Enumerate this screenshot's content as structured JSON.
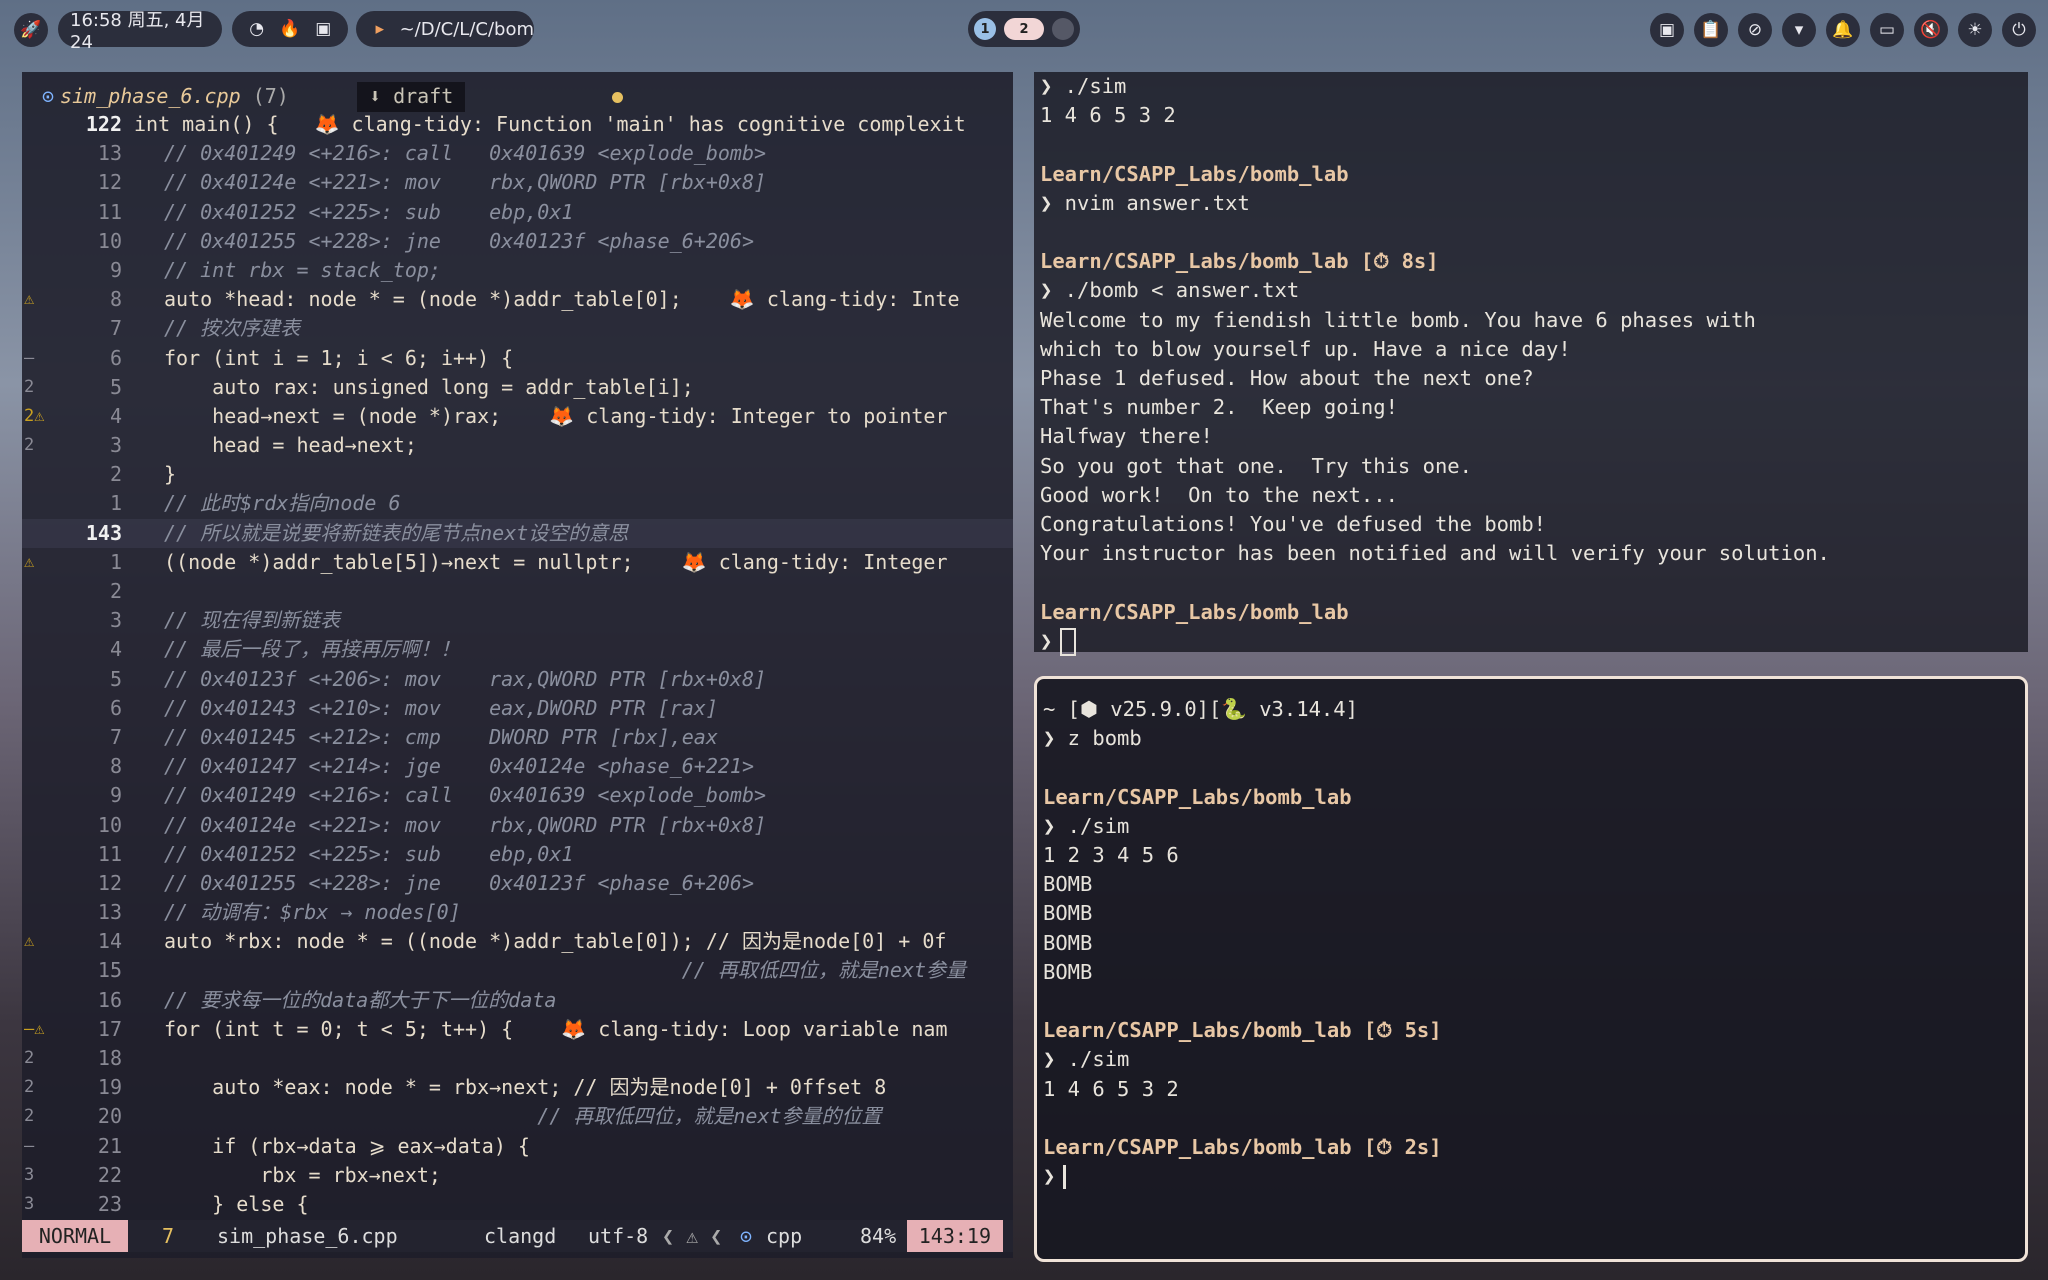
{
  "topbar": {
    "datetime": "16:58 周五, 4月 24",
    "path": "~/D/C/L/C/bom",
    "workspace_1": "1",
    "workspace_2": "2"
  },
  "editor": {
    "filename": "sim_phase_6.cpp",
    "error_count": "(7)",
    "branch": "draft",
    "lines": [
      {
        "sign": "",
        "num": "122",
        "cur": false,
        "code": "int main() {   🦊 clang-tidy: Function 'main' has cognitive complexit"
      },
      {
        "sign": "",
        "num": "13",
        "code": "// 0x401249 <+216>: call   0x401639 <explode_bomb>"
      },
      {
        "sign": "",
        "num": "12",
        "code": "// 0x40124e <+221>: mov    rbx,QWORD PTR [rbx+0x8]"
      },
      {
        "sign": "",
        "num": "11",
        "code": "// 0x401252 <+225>: sub    ebp,0x1"
      },
      {
        "sign": "",
        "num": "10",
        "code": "// 0x401255 <+228>: jne    0x40123f <phase_6+206>"
      },
      {
        "sign": "",
        "num": "9",
        "code": "// int rbx = stack_top;"
      },
      {
        "sign": "⚠",
        "num": "8",
        "code": "auto *head: node * = (node *)addr_table[0];    🦊 clang-tidy: Inte"
      },
      {
        "sign": "",
        "num": "7",
        "code": "// 按次序建表"
      },
      {
        "sign": "–",
        "num": "6",
        "code": "for (int i = 1; i < 6; i++) {"
      },
      {
        "sign": "2",
        "num": "5",
        "code": "    auto rax: unsigned long = addr_table[i];"
      },
      {
        "sign": "2⚠",
        "num": "4",
        "code": "    head→next = (node *)rax;    🦊 clang-tidy: Integer to pointer"
      },
      {
        "sign": "2",
        "num": "3",
        "code": "    head = head→next;"
      },
      {
        "sign": "",
        "num": "2",
        "code": "}"
      },
      {
        "sign": "",
        "num": "1",
        "code": "// 此时$rdx指向node 6"
      },
      {
        "sign": "",
        "num": "143",
        "code": "// 所以就是说要将新链表的尾节点next设空的意思"
      },
      {
        "sign": "⚠",
        "num": "1",
        "code": "((node *)addr_table[5])→next = nullptr;    🦊 clang-tidy: Integer"
      },
      {
        "sign": "",
        "num": "2",
        "code": ""
      },
      {
        "sign": "",
        "num": "3",
        "code": "// 现在得到新链表"
      },
      {
        "sign": "",
        "num": "4",
        "code": "// 最后一段了，再接再厉啊！！"
      },
      {
        "sign": "",
        "num": "5",
        "code": "// 0x40123f <+206>: mov    rax,QWORD PTR [rbx+0x8]"
      },
      {
        "sign": "",
        "num": "6",
        "code": "// 0x401243 <+210>: mov    eax,DWORD PTR [rax]"
      },
      {
        "sign": "",
        "num": "7",
        "code": "// 0x401245 <+212>: cmp    DWORD PTR [rbx],eax"
      },
      {
        "sign": "",
        "num": "8",
        "code": "// 0x401247 <+214>: jge    0x40124e <phase_6+221>"
      },
      {
        "sign": "",
        "num": "9",
        "code": "// 0x401249 <+216>: call   0x401639 <explode_bomb>"
      },
      {
        "sign": "",
        "num": "10",
        "code": "// 0x40124e <+221>: mov    rbx,QWORD PTR [rbx+0x8]"
      },
      {
        "sign": "",
        "num": "11",
        "code": "// 0x401252 <+225>: sub    ebp,0x1"
      },
      {
        "sign": "",
        "num": "12",
        "code": "// 0x401255 <+228>: jne    0x40123f <phase_6+206>"
      },
      {
        "sign": "",
        "num": "13",
        "code": "// 动调有：$rbx → nodes[0]"
      },
      {
        "sign": "⚠",
        "num": "14",
        "code": "auto *rbx: node * = ((node *)addr_table[0]); // 因为是node[0] + 0f"
      },
      {
        "sign": "",
        "num": "15",
        "code": "                                           // 再取低四位，就是next参量"
      },
      {
        "sign": "",
        "num": "16",
        "code": "// 要求每一位的data都大于下一位的data"
      },
      {
        "sign": "–⚠",
        "num": "17",
        "code": "for (int t = 0; t < 5; t++) {    🦊 clang-tidy: Loop variable nam"
      },
      {
        "sign": "2",
        "num": "18",
        "code": ""
      },
      {
        "sign": "2",
        "num": "19",
        "code": "    auto *eax: node * = rbx→next; // 因为是node[0] + 0ffset 8"
      },
      {
        "sign": "2",
        "num": "20",
        "code": "                               // 再取低四位，就是next参量的位置"
      },
      {
        "sign": "–",
        "num": "21",
        "code": "    if (rbx→data ⩾ eax→data) {"
      },
      {
        "sign": "3",
        "num": "22",
        "code": "        rbx = rbx→next;"
      },
      {
        "sign": "3",
        "num": "23",
        "code": "    } else {"
      }
    ]
  },
  "statusline": {
    "mode": "NORMAL",
    "count": "7",
    "file": "sim_phase_6.cpp",
    "lsp": "clangd",
    "encoding": "utf-8",
    "filetype": "cpp",
    "percent": "84%",
    "position": "143:19"
  },
  "term1": [
    "❯ ./sim",
    "1 4 6 5 3 2",
    "",
    "Learn/CSAPP_Labs/bomb_lab",
    "❯ nvim answer.txt",
    "",
    "Learn/CSAPP_Labs/bomb_lab [⏱ 8s]",
    "❯ ./bomb < answer.txt",
    "Welcome to my fiendish little bomb. You have 6 phases with",
    "which to blow yourself up. Have a nice day!",
    "Phase 1 defused. How about the next one?",
    "That's number 2.  Keep going!",
    "Halfway there!",
    "So you got that one.  Try this one.",
    "Good work!  On to the next...",
    "Congratulations! You've defused the bomb!",
    "Your instructor has been notified and will verify your solution.",
    "",
    "Learn/CSAPP_Labs/bomb_lab",
    "❯"
  ],
  "term2": [
    "~ [⬢ v25.9.0][🐍 v3.14.4]",
    "❯ z bomb",
    "",
    "Learn/CSAPP_Labs/bomb_lab",
    "❯ ./sim",
    "1 2 3 4 5 6",
    "BOMB",
    "BOMB",
    "BOMB",
    "BOMB",
    "",
    "Learn/CSAPP_Labs/bomb_lab [⏱ 5s]",
    "❯ ./sim",
    "1 4 6 5 3 2",
    "",
    "Learn/CSAPP_Labs/bomb_lab [⏱ 2s]",
    "❯"
  ],
  "icons": [
    "rocket-icon",
    "gauge-icon",
    "flame-icon",
    "cpu-icon",
    "terminal-icon",
    "chip-icon",
    "clipboard-icon",
    "eye-off-icon",
    "dropdown-icon",
    "bell-icon",
    "battery-icon",
    "mute-icon",
    "brightness-icon",
    "power-icon"
  ]
}
